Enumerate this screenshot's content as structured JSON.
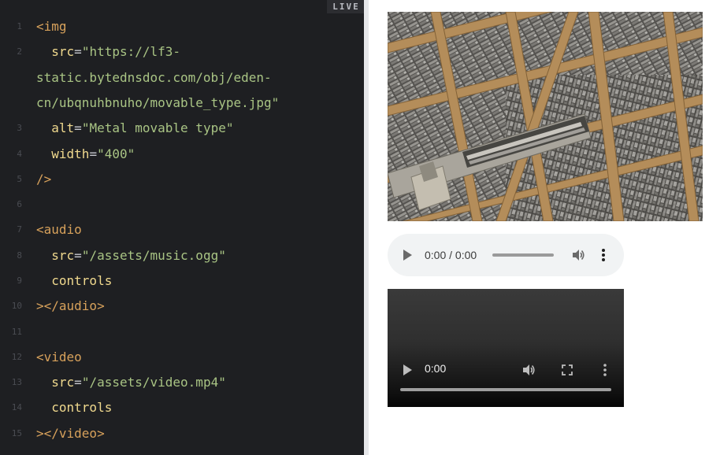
{
  "editor": {
    "live_badge": "LIVE",
    "lines": [
      {
        "n": "1",
        "segments": [
          {
            "c": "tag",
            "t": "<img"
          }
        ]
      },
      {
        "n": "2",
        "segments": [
          {
            "c": "attr",
            "t": "  src"
          },
          {
            "c": "punct",
            "t": "="
          },
          {
            "c": "str",
            "t": "\"https://lf3-"
          }
        ]
      },
      {
        "n": "",
        "segments": [
          {
            "c": "str",
            "t": "static.bytednsdoc.com/obj/eden-"
          }
        ]
      },
      {
        "n": "",
        "segments": [
          {
            "c": "str",
            "t": "cn/ubqnuhbnuho/movable_type.jpg\""
          }
        ]
      },
      {
        "n": "3",
        "segments": [
          {
            "c": "attr",
            "t": "  alt"
          },
          {
            "c": "punct",
            "t": "="
          },
          {
            "c": "str",
            "t": "\"Metal movable type\""
          }
        ]
      },
      {
        "n": "4",
        "segments": [
          {
            "c": "attr",
            "t": "  width"
          },
          {
            "c": "punct",
            "t": "="
          },
          {
            "c": "str",
            "t": "\"400\""
          }
        ]
      },
      {
        "n": "5",
        "segments": [
          {
            "c": "tag",
            "t": "/>"
          }
        ]
      },
      {
        "n": "6",
        "segments": []
      },
      {
        "n": "7",
        "segments": [
          {
            "c": "tag",
            "t": "<audio"
          }
        ]
      },
      {
        "n": "8",
        "segments": [
          {
            "c": "attr",
            "t": "  src"
          },
          {
            "c": "punct",
            "t": "="
          },
          {
            "c": "str",
            "t": "\"/assets/music.ogg\""
          }
        ]
      },
      {
        "n": "9",
        "segments": [
          {
            "c": "attr",
            "t": "  controls"
          }
        ]
      },
      {
        "n": "10",
        "segments": [
          {
            "c": "tag",
            "t": "></audio>"
          }
        ]
      },
      {
        "n": "11",
        "segments": []
      },
      {
        "n": "12",
        "segments": [
          {
            "c": "tag",
            "t": "<video"
          }
        ]
      },
      {
        "n": "13",
        "segments": [
          {
            "c": "attr",
            "t": "  src"
          },
          {
            "c": "punct",
            "t": "="
          },
          {
            "c": "str",
            "t": "\"/assets/video.mp4\""
          }
        ]
      },
      {
        "n": "14",
        "segments": [
          {
            "c": "attr",
            "t": "  controls"
          }
        ]
      },
      {
        "n": "15",
        "segments": [
          {
            "c": "tag",
            "t": "></video>"
          }
        ]
      }
    ]
  },
  "preview": {
    "audio": {
      "time": "0:00 / 0:00",
      "progress": 0,
      "icons": [
        "play-icon",
        "volume-icon",
        "more-options-icon"
      ]
    },
    "video": {
      "time": "0:00",
      "progress": 0,
      "icons": [
        "play-icon",
        "volume-icon",
        "fullscreen-icon",
        "more-options-icon"
      ]
    }
  },
  "colors": {
    "editor_bg": "#1e1f22",
    "tag": "#d7a15b",
    "attribute": "#f0d98e",
    "string": "#a9c484",
    "line_number": "#4a4c52",
    "audio_bg": "#f1f3f4"
  }
}
